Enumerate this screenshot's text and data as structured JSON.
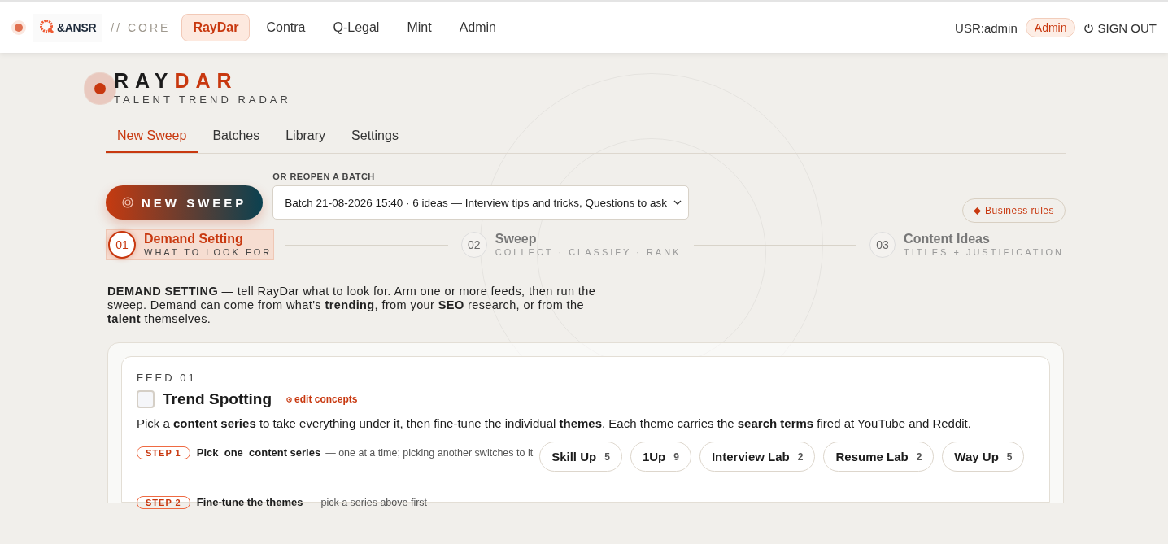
{
  "topbar": {
    "logo": "&ANSR",
    "section": "// CORE",
    "user": "USR:admin",
    "role": "Admin",
    "sign_out": "SIGN OUT",
    "nav": [
      {
        "label": "RayDar",
        "selected": true
      },
      {
        "label": "Contra",
        "selected": false
      },
      {
        "label": "Q-Legal",
        "selected": false
      },
      {
        "label": "Mint",
        "selected": false
      },
      {
        "label": "Admin",
        "selected": false
      }
    ]
  },
  "brand": {
    "title_plain": "RAY",
    "title_accent": "DAR",
    "subtitle": "TALENT TREND RADAR"
  },
  "tabs": [
    {
      "label": "New Sweep",
      "selected": true
    },
    {
      "label": "Batches",
      "selected": false
    },
    {
      "label": "Library",
      "selected": false
    },
    {
      "label": "Settings",
      "selected": false
    }
  ],
  "new_sweep": "NEW SWEEP",
  "reopen": {
    "label": "OR REOPEN A BATCH",
    "value": "Batch 21-08-2026 15:40 · 6 ideas — Interview tips and tricks, Questions to ask"
  },
  "business_rules": "Business rules",
  "steps": [
    {
      "number": "01",
      "title": "Demand Setting",
      "subtitle": "WHAT TO LOOK FOR",
      "selected": true
    },
    {
      "number": "02",
      "title": "Sweep",
      "subtitle": "COLLECT · CLASSIFY · RANK",
      "selected": false
    },
    {
      "number": "03",
      "title": "Content Ideas",
      "subtitle": "TITLES + JUSTIFICATION",
      "selected": false
    }
  ],
  "intro": "**DEMAND SETTING** — tell RayDar what to look for. Arm one or more feeds, then run the sweep. Demand can come from what's **trending**, from your **SEO** research, or from the **talent** themselves.",
  "feed": {
    "label": "FEED 01",
    "checked": false,
    "title": "Trend Spotting",
    "edit": "edit concepts",
    "description": "Pick a **content series** to take everything under it, then fine-tune the individual **themes**. Each theme carries the **search terms** fired at YouTube and Reddit.",
    "step1": {
      "badge": "STEP 1",
      "title": "Pick  one  content series",
      "hint": "— one at a time; picking another switches to it"
    },
    "series": [
      {
        "name": "Skill Up",
        "count": "5",
        "selected": false
      },
      {
        "name": "1Up",
        "count": "9",
        "selected": false
      },
      {
        "name": "Interview Lab",
        "count": "2",
        "selected": false
      },
      {
        "name": "Resume Lab",
        "count": "2",
        "selected": false
      },
      {
        "name": "Way Up",
        "count": "5",
        "selected": false
      }
    ],
    "step2": {
      "badge": "STEP 2",
      "title": "Fine-tune the themes",
      "hint": "— pick a series above first"
    }
  }
}
